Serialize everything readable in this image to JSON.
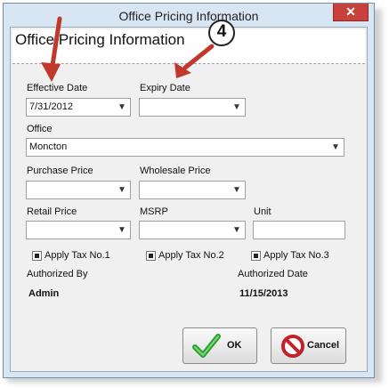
{
  "window": {
    "title": "Office Pricing Information",
    "close_label": "✕"
  },
  "header": {
    "title": "Office Pricing Information"
  },
  "annotation": {
    "badge": "4"
  },
  "fields": {
    "effective_date": {
      "label": "Effective Date",
      "value": "7/31/2012"
    },
    "expiry_date": {
      "label": "Expiry Date",
      "value": ""
    },
    "office": {
      "label": "Office",
      "value": "Moncton"
    },
    "purchase_price": {
      "label": "Purchase Price",
      "value": ""
    },
    "wholesale_price": {
      "label": "Wholesale Price",
      "value": ""
    },
    "retail_price": {
      "label": "Retail Price",
      "value": ""
    },
    "msrp": {
      "label": "MSRP",
      "value": ""
    },
    "unit": {
      "label": "Unit",
      "value": ""
    }
  },
  "taxes": [
    {
      "label": "Apply Tax No.1",
      "checked": true
    },
    {
      "label": "Apply Tax No.2",
      "checked": true
    },
    {
      "label": "Apply Tax No.3",
      "checked": true
    }
  ],
  "authorized_by": {
    "label": "Authorized By",
    "value": "Admin"
  },
  "authorized_date": {
    "label": "Authorized Date",
    "value": "11/15/2013"
  },
  "buttons": {
    "ok": "OK",
    "cancel": "Cancel"
  },
  "colors": {
    "accent_arrow": "#c0392b",
    "ok_check": "#2e9e2e",
    "cancel_icon": "#c0232b"
  }
}
